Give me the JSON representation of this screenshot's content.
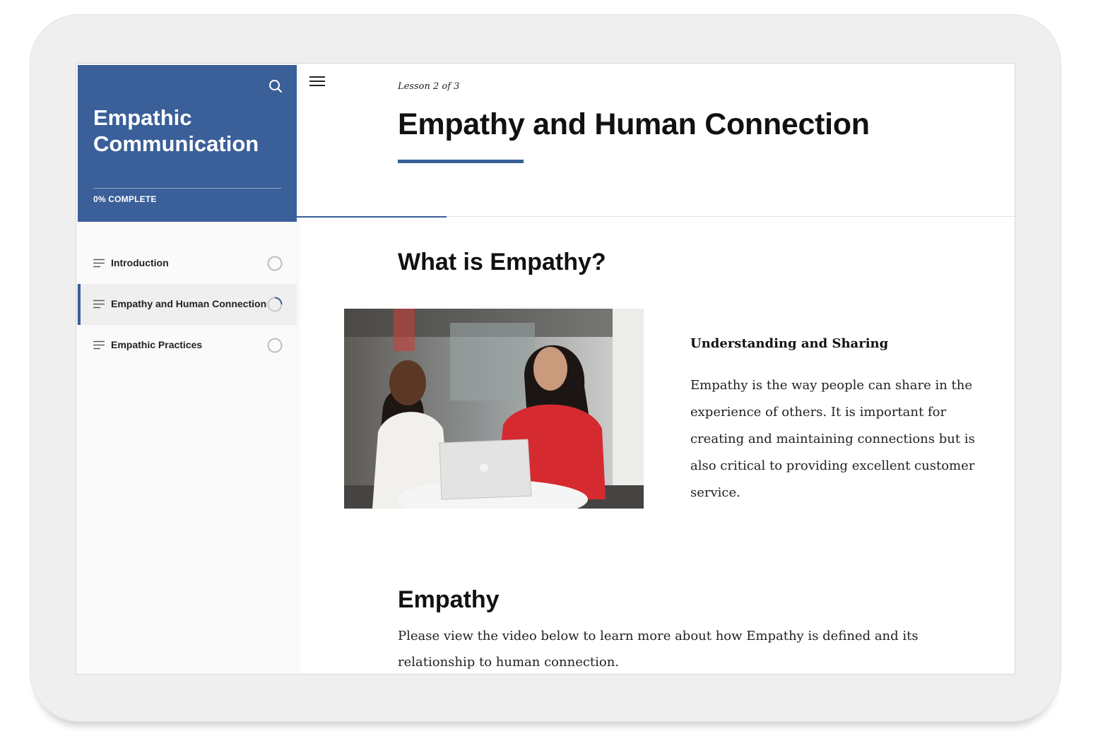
{
  "sidebar": {
    "course_title": "Empathic Communication",
    "progress_text": "0% COMPLETE",
    "search_icon": "search-icon",
    "lessons": [
      {
        "label": "Introduction",
        "status": "not-started",
        "active": false
      },
      {
        "label": "Empathy and Human Connection",
        "status": "in-progress",
        "active": true
      },
      {
        "label": "Empathic Practices",
        "status": "not-started",
        "active": false
      }
    ]
  },
  "header": {
    "menu_icon": "hamburger-menu-icon",
    "lesson_counter": "Lesson 2 of 3",
    "lesson_title": "Empathy and Human Connection"
  },
  "content": {
    "section1": {
      "heading": "What is Empathy?",
      "subheading": "Understanding and Sharing",
      "paragraph": "Empathy is the way people can share in the experience of others. It is important for creating and maintaining connections but is also critical to providing excellent customer service."
    },
    "section2": {
      "heading": "Empathy",
      "paragraph": "Please view the video below to learn more about how Empathy is defined and its relationship to human connection."
    }
  },
  "colors": {
    "accent": "#3a5f99",
    "sidebar_bg": "#fafafa",
    "active_item_bg": "#efefef"
  }
}
